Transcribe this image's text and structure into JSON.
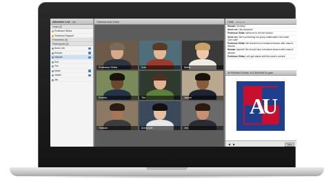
{
  "attendee_list": {
    "title": "Attendee List",
    "count": "(18)",
    "hosts_group": {
      "label": "Hosts",
      "count": "(2)"
    },
    "hosts": [
      "Professor Shiba",
      "Technical Support"
    ],
    "presenters_group": {
      "label": "Presenters",
      "count": "(0)"
    },
    "participants_group": {
      "label": "Participants",
      "count": "(8)"
    },
    "participants": [
      "Anna Lee",
      "Emeka",
      "Hassan",
      "Sue",
      "Tim",
      "Marie",
      "Janice",
      "Jim"
    ]
  },
  "camera": {
    "title": "Camera and Voice",
    "tiles": [
      {
        "name": "Professor Shiba",
        "skin": "#d7a98a",
        "hair": "#7a6a5a",
        "shirt": "#2d3540",
        "bg": "#6d5b4a"
      },
      {
        "name": "Sue",
        "skin": "#e4b894",
        "hair": "#5a3a22",
        "shirt": "#9a3a2a",
        "bg": "#4e6f7a"
      },
      {
        "name": "Marie",
        "skin": "#edc8a8",
        "hair": "#c9a06a",
        "shirt": "#f0ece4",
        "bg": "#3a3a3a"
      },
      {
        "name": "Emeka",
        "skin": "#6b4630",
        "hair": "#1c120c",
        "shirt": "#243447",
        "bg": "#7a8a5a"
      },
      {
        "name": "Tim",
        "skin": "#e2b08e",
        "hair": "#4a3020",
        "shirt": "#5d7f3e",
        "bg": "#2e3a2e"
      },
      {
        "name": "Janice",
        "skin": "#8a5a3c",
        "hair": "#1a120c",
        "shirt": "#1e2530",
        "bg": "#b8a890"
      },
      {
        "name": "Hassan",
        "skin": "#a87656",
        "hair": "#2a1c14",
        "shirt": "#3c3c3c",
        "bg": "#8a7a64"
      },
      {
        "name": "Anna Lee",
        "skin": "#e8c0a0",
        "hair": "#151010",
        "shirt": "#e8e8e8",
        "bg": "#3a4a5a"
      },
      {
        "name": "Jim",
        "skin": "#c89070",
        "hair": "#2a1a10",
        "shirt": "#2b2b35",
        "bg": "#6a6a6a"
      }
    ]
  },
  "chat": {
    "title": "Chat",
    "audience": "Everyone",
    "messages": [
      {
        "author": "Hassan:",
        "text": "Morning!"
      },
      {
        "author": "Anna Lee:",
        "text": "Hey everyone!"
      },
      {
        "author": "Professor Shiba:",
        "text": "Welcome to the live session."
      },
      {
        "author": "Anna Lee:",
        "text": "We're presenting our group collaboration next week. Can't wait!"
      },
      {
        "author": "Professor Shiba:",
        "text": "We should form a breakout session after class to discuss."
      },
      {
        "author": "Hassan:",
        "text": "Agreed!! We should have a breakout session after class to discuss."
      },
      {
        "author": "Professor Shiba:",
        "text": "Let's get started with this week's content."
      }
    ]
  },
  "file": {
    "title": "INTERNATIONAL ECONOMICS.pptx",
    "logo_letters": "AU",
    "sync_label": "Sync",
    "prev_icon": "◀",
    "next_icon": "▶"
  },
  "colors": {
    "logo_red": "#c8102e",
    "logo_blue": "#1f3f8c"
  }
}
